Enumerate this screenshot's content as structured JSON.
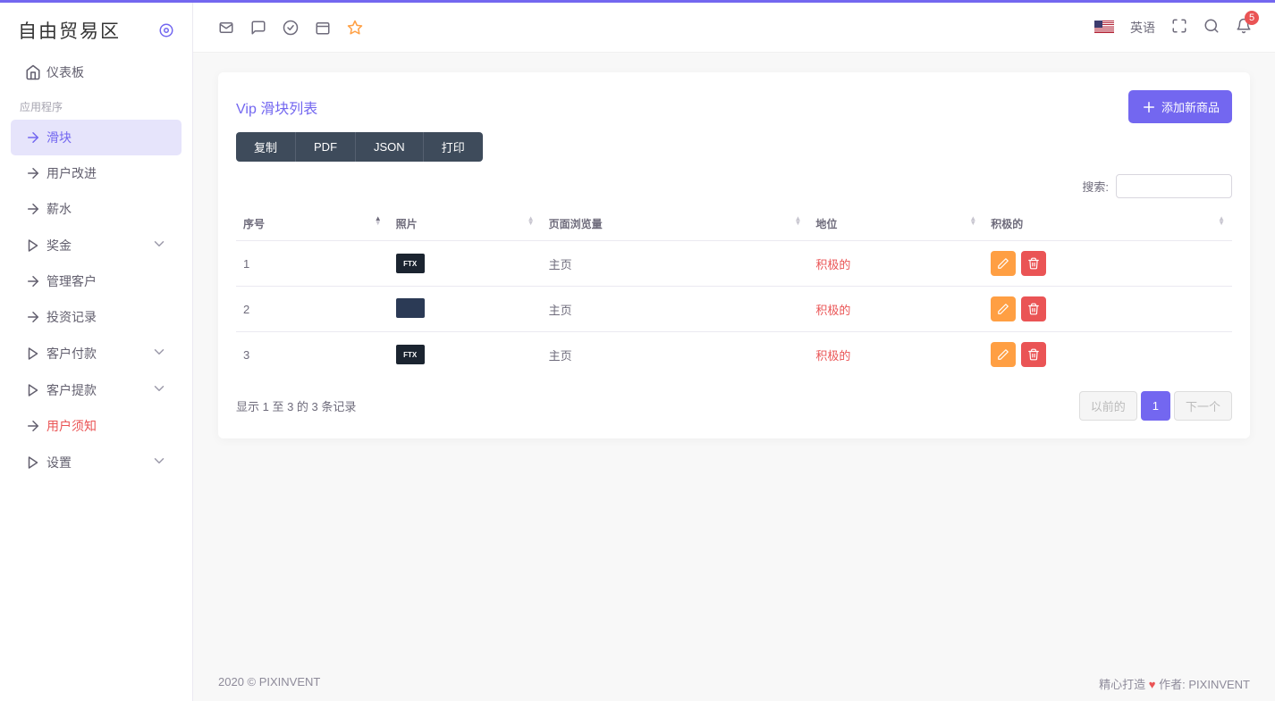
{
  "brand": {
    "title": "自由贸易区"
  },
  "nav": {
    "dashboard": "仪表板",
    "section_apps": "应用程序",
    "slider": "滑块",
    "user_improve": "用户改进",
    "salary": "薪水",
    "bonus": "奖金",
    "manage_customers": "管理客户",
    "invest_records": "投资记录",
    "customer_payments": "客户付款",
    "customer_withdraw": "客户提款",
    "user_notice": "用户须知",
    "settings": "设置"
  },
  "topbar": {
    "language": "英语",
    "notif_count": "5"
  },
  "card": {
    "title": "Vip 滑块列表",
    "add_btn": "添加新商品",
    "export": {
      "copy": "复制",
      "pdf": "PDF",
      "json": "JSON",
      "print": "打印"
    },
    "search_label": "搜索:"
  },
  "table": {
    "headers": {
      "seq": "序号",
      "photo": "照片",
      "pageviews": "页面浏览量",
      "status": "地位",
      "active": "积极的"
    },
    "rows": [
      {
        "seq": "1",
        "thumb_text": "FTX",
        "thumb_class": "",
        "pageview": "主页",
        "status": "积极的"
      },
      {
        "seq": "2",
        "thumb_text": "",
        "thumb_class": "blue",
        "pageview": "主页",
        "status": "积极的"
      },
      {
        "seq": "3",
        "thumb_text": "FTX",
        "thumb_class": "",
        "pageview": "主页",
        "status": "积极的"
      }
    ],
    "info": "显示 1 至 3 的 3 条记录",
    "pagination": {
      "prev": "以前的",
      "page": "1",
      "next": "下一个"
    }
  },
  "footer": {
    "left": "2020 © PIXINVENT",
    "right_made": "精心打造",
    "right_author_label": "作者:",
    "right_author": "PIXINVENT"
  }
}
